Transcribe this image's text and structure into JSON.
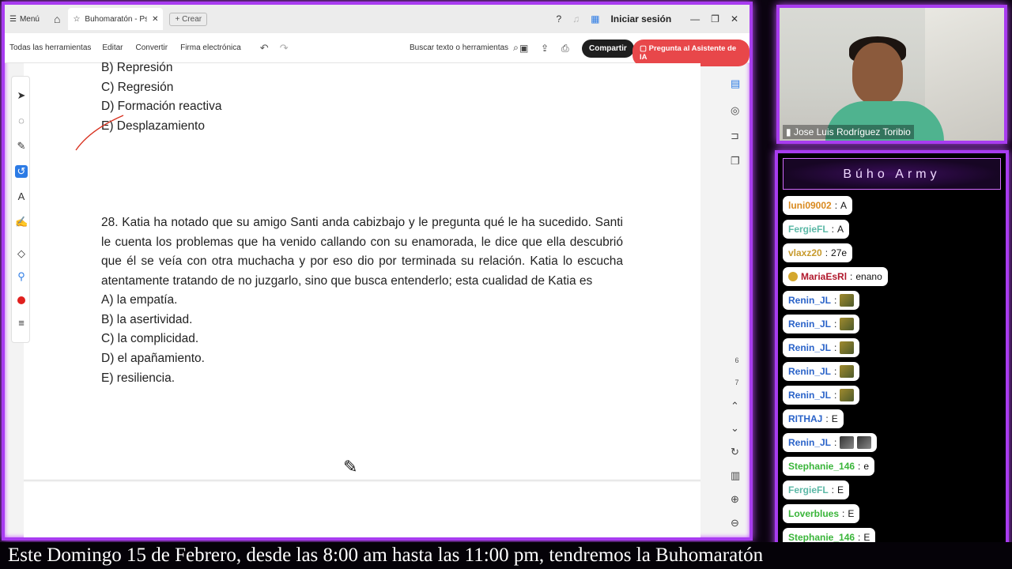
{
  "titlebar": {
    "menu": "Menú",
    "tab_title": "Buhomaratón - Psicol...",
    "new_tab": "Crear",
    "login": "Iniciar sesión"
  },
  "toolbar": {
    "all_tools": "Todas las herramientas",
    "edit": "Editar",
    "convert": "Convertir",
    "esign": "Firma electrónica",
    "search": "Buscar texto o herramientas",
    "share": "Compartir",
    "ai": "Pregunta al Asistente de IA"
  },
  "document": {
    "prev_options": [
      "B) Represión",
      "C) Regresión",
      "D) Formación reactiva",
      "E) Desplazamiento"
    ],
    "question": "28. Katia ha notado que su amigo Santi anda cabizbajo y le pregunta qué le ha sucedido. Santi le cuenta los problemas que ha venido callando con su enamorada, le dice que ella descubrió que él se veía con otra muchacha y por eso dio por terminada su relación. Katia lo escucha atentamente tratando de no juzgarlo, sino que busca entenderlo; esta cualidad de Katia es",
    "options": [
      "A) la empatía.",
      "B) la asertividad.",
      "C) la complicidad.",
      "D) el apañamiento.",
      "E) resiliencia."
    ],
    "page_numbers": [
      "6",
      "7"
    ]
  },
  "webcam": {
    "name": "Jose Luis Rodríguez Toribio"
  },
  "chat": {
    "title": "Búho Army",
    "messages": [
      {
        "user": "luni09002",
        "text": "A",
        "color": "#d98a1f"
      },
      {
        "user": "FergieFL",
        "text": "A",
        "color": "#5bb8a6"
      },
      {
        "user": "vlaxz20",
        "text": "27e",
        "color": "#c79a2c"
      },
      {
        "user": "MariaEsRl",
        "text": "enano",
        "color": "#b0182c"
      },
      {
        "user": "Renin_JL",
        "text": "",
        "color": "#2a63c9"
      },
      {
        "user": "Renin_JL",
        "text": "",
        "color": "#2a63c9"
      },
      {
        "user": "Renin_JL",
        "text": "",
        "color": "#2a63c9"
      },
      {
        "user": "Renin_JL",
        "text": "",
        "color": "#2a63c9"
      },
      {
        "user": "Renin_JL",
        "text": "",
        "color": "#2a63c9"
      },
      {
        "user": "RITHAJ",
        "text": "E",
        "color": "#2a63c9"
      },
      {
        "user": "Renin_JL",
        "text": "",
        "color": "#2a63c9"
      },
      {
        "user": "Stephanie_146",
        "text": "e",
        "color": "#3ab53a"
      },
      {
        "user": "FergieFL",
        "text": "E",
        "color": "#5bb8a6"
      },
      {
        "user": "Loverblues",
        "text": "E",
        "color": "#3ab53a"
      },
      {
        "user": "Stephanie_146",
        "text": "E",
        "color": "#3ab53a"
      }
    ]
  },
  "ticker": "Este Domingo 15 de Febrero, desde las 8:00 am hasta las 11:00 pm, tendremos la Buhomaratón",
  "colors": {
    "frame": "#a83cf0",
    "accent": "#2c7be5",
    "ai": "#e8474a"
  }
}
